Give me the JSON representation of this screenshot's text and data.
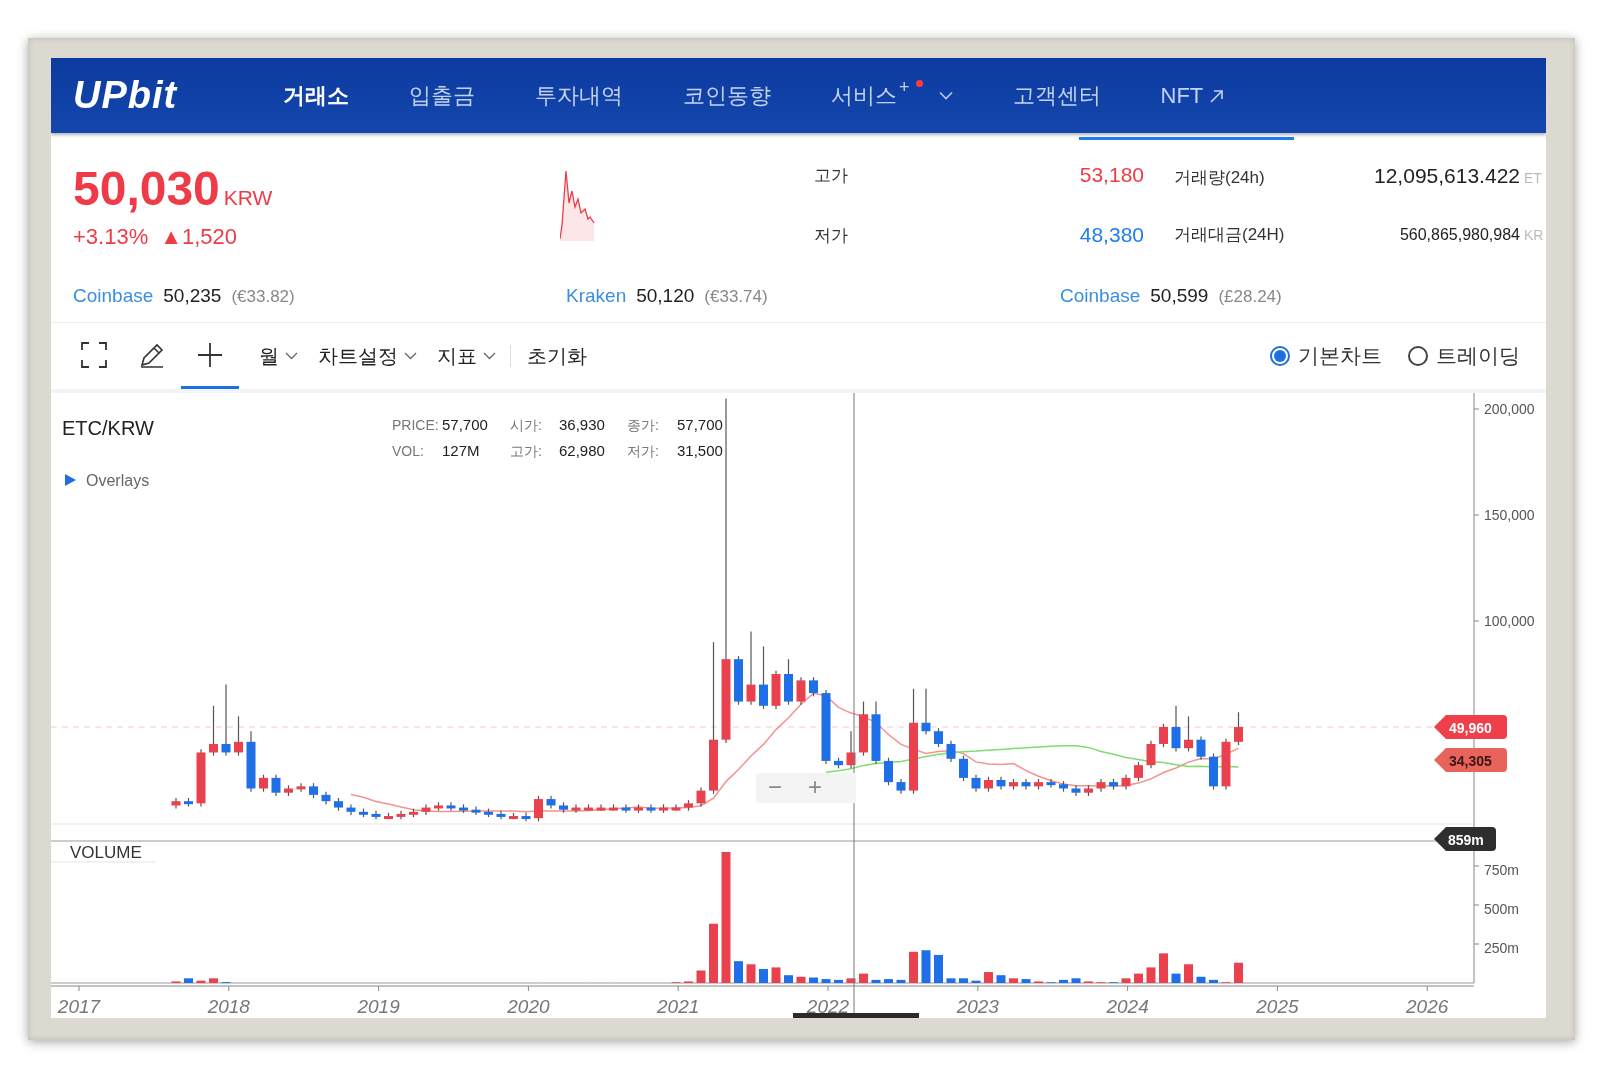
{
  "header": {
    "logo": "UPbit",
    "nav": [
      {
        "label": "거래소",
        "kind": "page",
        "selected": true
      },
      {
        "label": "입출금",
        "kind": "page",
        "selected": false
      },
      {
        "label": "투자내역",
        "kind": "page",
        "selected": false
      },
      {
        "label": "코인동향",
        "kind": "page",
        "selected": false
      },
      {
        "label": "서비스",
        "kind": "menu",
        "superscript": "+",
        "dot": true,
        "selected": false
      },
      {
        "label": "고객센터",
        "kind": "page",
        "selected": false
      },
      {
        "label": "NFT",
        "kind": "external",
        "selected": false
      }
    ]
  },
  "ticker": {
    "price": "50,030",
    "currency": "KRW",
    "change_rate": "+3.13%",
    "change_arrow": "▲",
    "change_amount": "1,520",
    "stats": [
      {
        "label": "고가",
        "value": "53,180",
        "color": "#ef3b47"
      },
      {
        "label": "저가",
        "value": "48,380",
        "color": "#1e7ef0"
      }
    ],
    "volumes": [
      {
        "label": "거래량(24h)",
        "value": "12,095,613.422",
        "unit": "ET",
        "kind": "large"
      },
      {
        "label": "거래대금(24H)",
        "value": "560,865,980,984",
        "unit": "KR",
        "kind": "small"
      }
    ]
  },
  "exchanges": [
    {
      "name": "Coinbase",
      "price": "50,235",
      "converted": "(€33.82)"
    },
    {
      "name": "Kraken",
      "price": "50,120",
      "converted": "(€33.74)"
    },
    {
      "name": "Coinbase",
      "price": "50,599",
      "converted": "(£28.24)"
    }
  ],
  "toolbar": {
    "tools": [
      {
        "kind": "fullscreen",
        "selected": false
      },
      {
        "kind": "draw",
        "selected": false
      },
      {
        "kind": "crosshair",
        "selected": true
      }
    ],
    "menus": [
      {
        "label": "월"
      },
      {
        "label": "차트설정"
      },
      {
        "label": "지표"
      }
    ],
    "reset": "초기화",
    "chart_types": [
      {
        "label": "기본차트",
        "selected": true
      },
      {
        "label": "트레이딩",
        "selected": false
      }
    ]
  },
  "chart": {
    "symbol": "ETC/KRW",
    "legend": [
      {
        "label": "PRICE:",
        "value": "57,700"
      },
      {
        "label": "시가:",
        "value": "36,930"
      },
      {
        "label": "종가:",
        "value": "57,700"
      },
      {
        "label": "VOL:",
        "value": "127M"
      },
      {
        "label": "고가:",
        "value": "62,980"
      },
      {
        "label": "저가:",
        "value": "31,500"
      }
    ],
    "overlays": {
      "label": "Overlays",
      "expanded": false
    },
    "price_ticks": [
      "200,000",
      "150,000",
      "100,000"
    ],
    "price_tags": [
      {
        "value": "49,960",
        "color": "#ee3f4b"
      },
      {
        "value": "34,305",
        "color": "#e8635c"
      }
    ],
    "zoom_controls": [
      "−",
      "+"
    ],
    "volume_title": "VOLUME",
    "volume_tag": "859m",
    "volume_ticks": [
      "750m",
      "500m",
      "250m"
    ],
    "years": [
      "2017",
      "2018",
      "2019",
      "2020",
      "2021",
      "2022",
      "2023",
      "2024",
      "2025",
      "2026"
    ]
  }
}
